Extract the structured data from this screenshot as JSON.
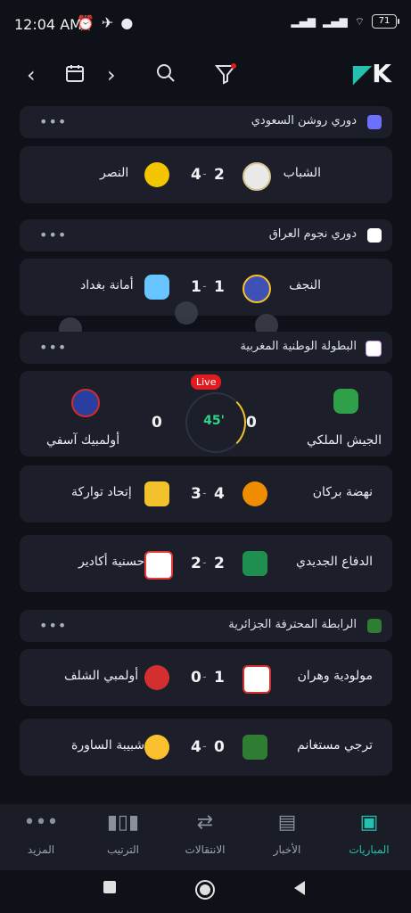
{
  "status_bar": {
    "time": "12:04 AM",
    "battery": "71",
    "icons": [
      "alarm-icon",
      "network-icon",
      "app-icon",
      "signal-icon",
      "signal2-icon",
      "wifi-icon"
    ]
  },
  "topbar": {
    "icons": [
      "prev-icon",
      "calendar-icon",
      "next-icon",
      "search-icon",
      "filter-icon",
      "logo-icon"
    ],
    "filter_dot_color": "#e11b1f"
  },
  "colors": {
    "accent": "#24c0b0",
    "live_red": "#e11b1f",
    "live_minute": "#2bd58b",
    "arc": "#f3c12b"
  },
  "leagues": [
    {
      "name": "دوري روشن السعودي",
      "matches": [
        {
          "home": "الشباب",
          "home_score": "2",
          "away_score": "4",
          "away": "النصر"
        }
      ]
    },
    {
      "name": "دوري نجوم العراق",
      "matches": [
        {
          "home": "النجف",
          "home_score": "1",
          "away_score": "1",
          "away": "أمانة بغداد"
        }
      ]
    },
    {
      "name": "البطولة الوطنية المغربية",
      "live": {
        "badge": "Live",
        "minute": "45'",
        "home": "الجيش الملكي",
        "home_score": "0",
        "away_score": "0",
        "away": "أولمبيك آسفي"
      },
      "matches": [
        {
          "home": "نهضة بركان",
          "home_score": "4",
          "away_score": "3",
          "away": "إتحاد تواركة"
        },
        {
          "home": "الدفاع الجديدي",
          "home_score": "2",
          "away_score": "2",
          "away": "حسنية أكادير"
        }
      ]
    },
    {
      "name": "الرابطة المحترفة الجزائرية",
      "matches": [
        {
          "home": "مولودية وهران",
          "home_score": "1",
          "away_score": "0",
          "away": "أولمبي الشلف"
        },
        {
          "home": "ترجي مستغانم",
          "home_score": "0",
          "away_score": "4",
          "away": "شبيبة الساورة"
        }
      ]
    }
  ],
  "bottom_nav": [
    {
      "label": "المزيد",
      "icon": "more-icon"
    },
    {
      "label": "الترتيب",
      "icon": "standings-icon"
    },
    {
      "label": "الانتقالات",
      "icon": "transfers-icon"
    },
    {
      "label": "الأخبار",
      "icon": "news-icon"
    },
    {
      "label": "المباريات",
      "icon": "matches-icon"
    }
  ]
}
